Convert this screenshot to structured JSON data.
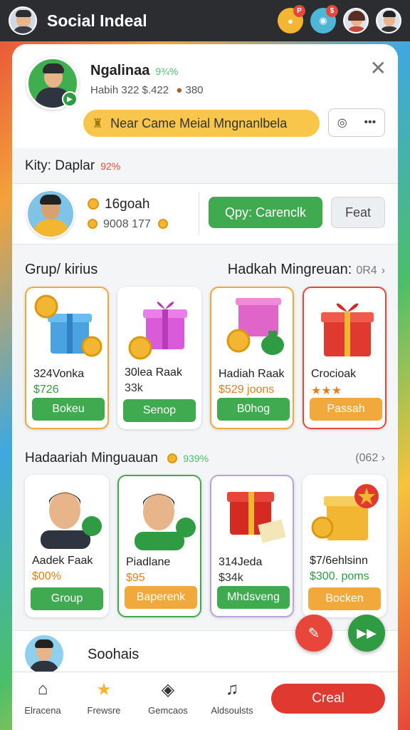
{
  "header": {
    "title": "Social Indeal",
    "coin_badge": "P",
    "coin_badge2": "$"
  },
  "profile": {
    "name": "Ngalinaa",
    "name_badge": "9¾%",
    "meta": "Habih 322 $.422",
    "meta_extra": "380",
    "banner": "Near Came  Meial Mngnanlbela"
  },
  "kity": {
    "label": "Kity: Daplar",
    "pct": "92%"
  },
  "referral": {
    "line1": "16goah",
    "line2": "9008 177",
    "copy_label": "Qpy: Carenclk",
    "feat_label": "Feat"
  },
  "section1": {
    "left_title": "Grup/ kirius",
    "right_title": "Hadkah Mingreuan:",
    "right_count": "0R4",
    "tiles": [
      {
        "name": "324Vonka",
        "value": "$726",
        "button": "Bokeu",
        "value_color": "green",
        "button_color": "green"
      },
      {
        "name": "30lea Raak",
        "value": "33k",
        "button": "Senop",
        "value_color": "dark",
        "button_color": "green"
      },
      {
        "name": "Hadiah Raak",
        "value": "$529 joons",
        "button": "B0hog",
        "value_color": "orange",
        "button_color": "green"
      },
      {
        "name": "Crocioak",
        "value": "★★★",
        "button": "Passah",
        "value_color": "orange",
        "button_color": "orange"
      }
    ]
  },
  "section2": {
    "left_title": "Hadaariah Minguauan",
    "left_pct": "939%",
    "right_count": "(062",
    "tiles": [
      {
        "name": "Aadek Faak",
        "value": "$00%",
        "button": "Group",
        "value_color": "orange",
        "button_color": "green"
      },
      {
        "name": "Piadlane",
        "value": "$95",
        "button": "Baperenk",
        "value_color": "orange",
        "button_color": "orange"
      },
      {
        "name": "314Jeda",
        "value": "$34k",
        "button": "Mhdsveng",
        "value_color": "dark",
        "button_color": "green"
      },
      {
        "name": "$7/6ehlsinn",
        "value": "$300. poms",
        "button": "Bocken",
        "value_color": "green",
        "button_color": "orange"
      }
    ]
  },
  "peek": {
    "label": "Soohais"
  },
  "nav": {
    "items": [
      {
        "label": "Elracena",
        "icon": "home-icon"
      },
      {
        "label": "Frewsre",
        "icon": "star-icon"
      },
      {
        "label": "Gemcaos",
        "icon": "games-icon"
      },
      {
        "label": "Aldsoulsts",
        "icon": "mic-icon"
      }
    ],
    "create_label": "Creal"
  },
  "colors": {
    "green": "#3faa4f",
    "orange": "#f0a93a",
    "red": "#e0392f",
    "topbar": "#2b2d31"
  }
}
